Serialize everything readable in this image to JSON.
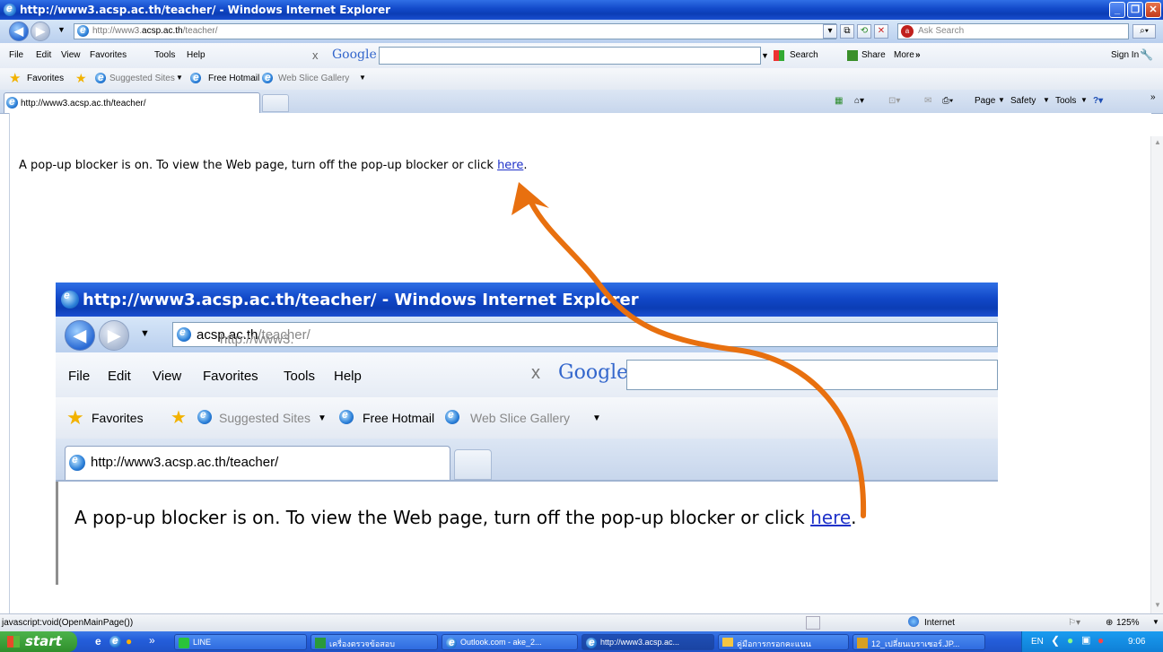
{
  "window": {
    "title": "http://www3.acsp.ac.th/teacher/ - Windows Internet Explorer"
  },
  "address": {
    "url_prefix": "http://www3.",
    "url_domain": "acsp.ac.th",
    "url_path": "/teacher/",
    "search_placeholder": "Ask Search"
  },
  "menu": {
    "file": "File",
    "edit": "Edit",
    "view": "View",
    "favorites": "Favorites",
    "tools": "Tools",
    "help": "Help",
    "google_x": "x",
    "google": "Google",
    "search": "Search",
    "share": "Share",
    "more": "More",
    "more_arrow": "»",
    "signin": "Sign In"
  },
  "favbar": {
    "favorites": "Favorites",
    "suggested": "Suggested Sites",
    "hotmail": "Free Hotmail",
    "webslice": "Web Slice Gallery"
  },
  "tab": {
    "label": "http://www3.acsp.ac.th/teacher/"
  },
  "commandbar": {
    "page": "Page",
    "safety": "Safety",
    "tools": "Tools"
  },
  "content": {
    "message": "A pop-up blocker is on. To view the Web page, turn off the pop-up blocker or click ",
    "link": "here",
    "period": "."
  },
  "inset": {
    "title": "http://www3.acsp.ac.th/teacher/ - Windows Internet Explorer",
    "url_prefix": "http://www3.",
    "url_domain": "acsp.ac.th",
    "url_path": "/teacher/",
    "tab": "http://www3.acsp.ac.th/teacher/",
    "message": "A pop-up blocker is on. To view the Web page, turn off the pop-up blocker or click ",
    "link": "here",
    "period": "."
  },
  "status": {
    "left": "javascript:void(OpenMainPage())",
    "zone": "Internet",
    "zoom": "125%"
  },
  "taskbar": {
    "start": "start",
    "items": [
      "LINE",
      "เครื่องตรวจข้อสอบ",
      "Outlook.com - ake_2...",
      "http://www3.acsp.ac...",
      "คู่มือการกรอกคะแนน",
      "12_เปลี่ยนเบราเซอร์.JP..."
    ],
    "lang": "EN",
    "time": "9:06"
  },
  "colors": {
    "title": "#1249c9",
    "arrow": "#e8700f",
    "link": "#1f32c9"
  }
}
